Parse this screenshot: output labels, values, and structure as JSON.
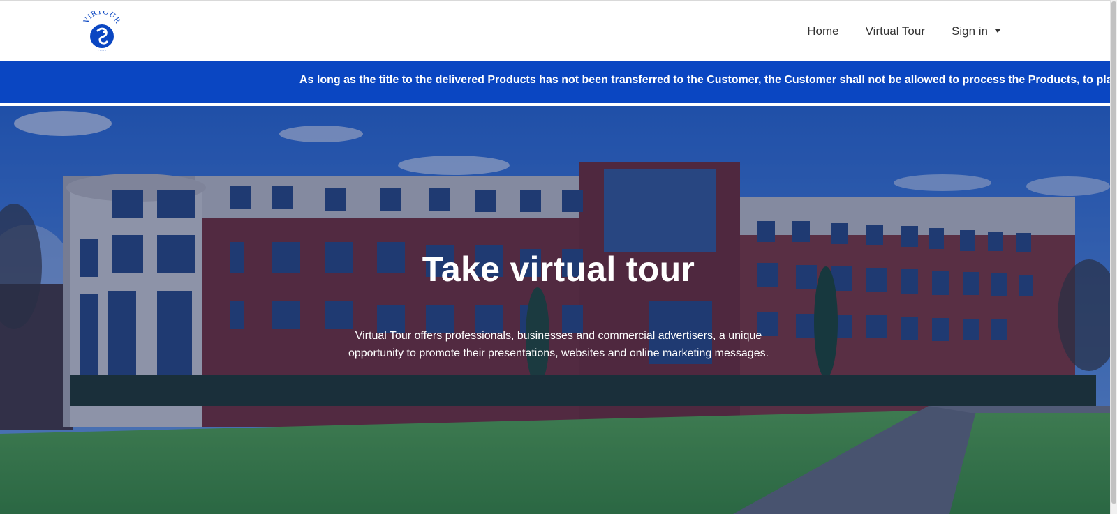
{
  "brand": {
    "logo_text": "VIRTOUR",
    "logo_tagline": "· · · · ·",
    "logo_color": "#0a46c2"
  },
  "nav": {
    "home": "Home",
    "virtual_tour": "Virtual Tour",
    "sign_in": "Sign in"
  },
  "ticker": {
    "text": "As long as the title to the delivered Products has not been transferred to the Customer, the Customer shall not be allowed to process the Products, to place the Products",
    "background": "#0a46c2"
  },
  "hero": {
    "title": "Take virtual tour",
    "subtitle": "Virtual Tour offers professionals, businesses and commercial advertisers, a unique opportunity to promote their presentations, websites and online marketing messages."
  },
  "icons": {
    "logo": "seal-logo-icon",
    "dropdown": "caret-down-icon"
  }
}
